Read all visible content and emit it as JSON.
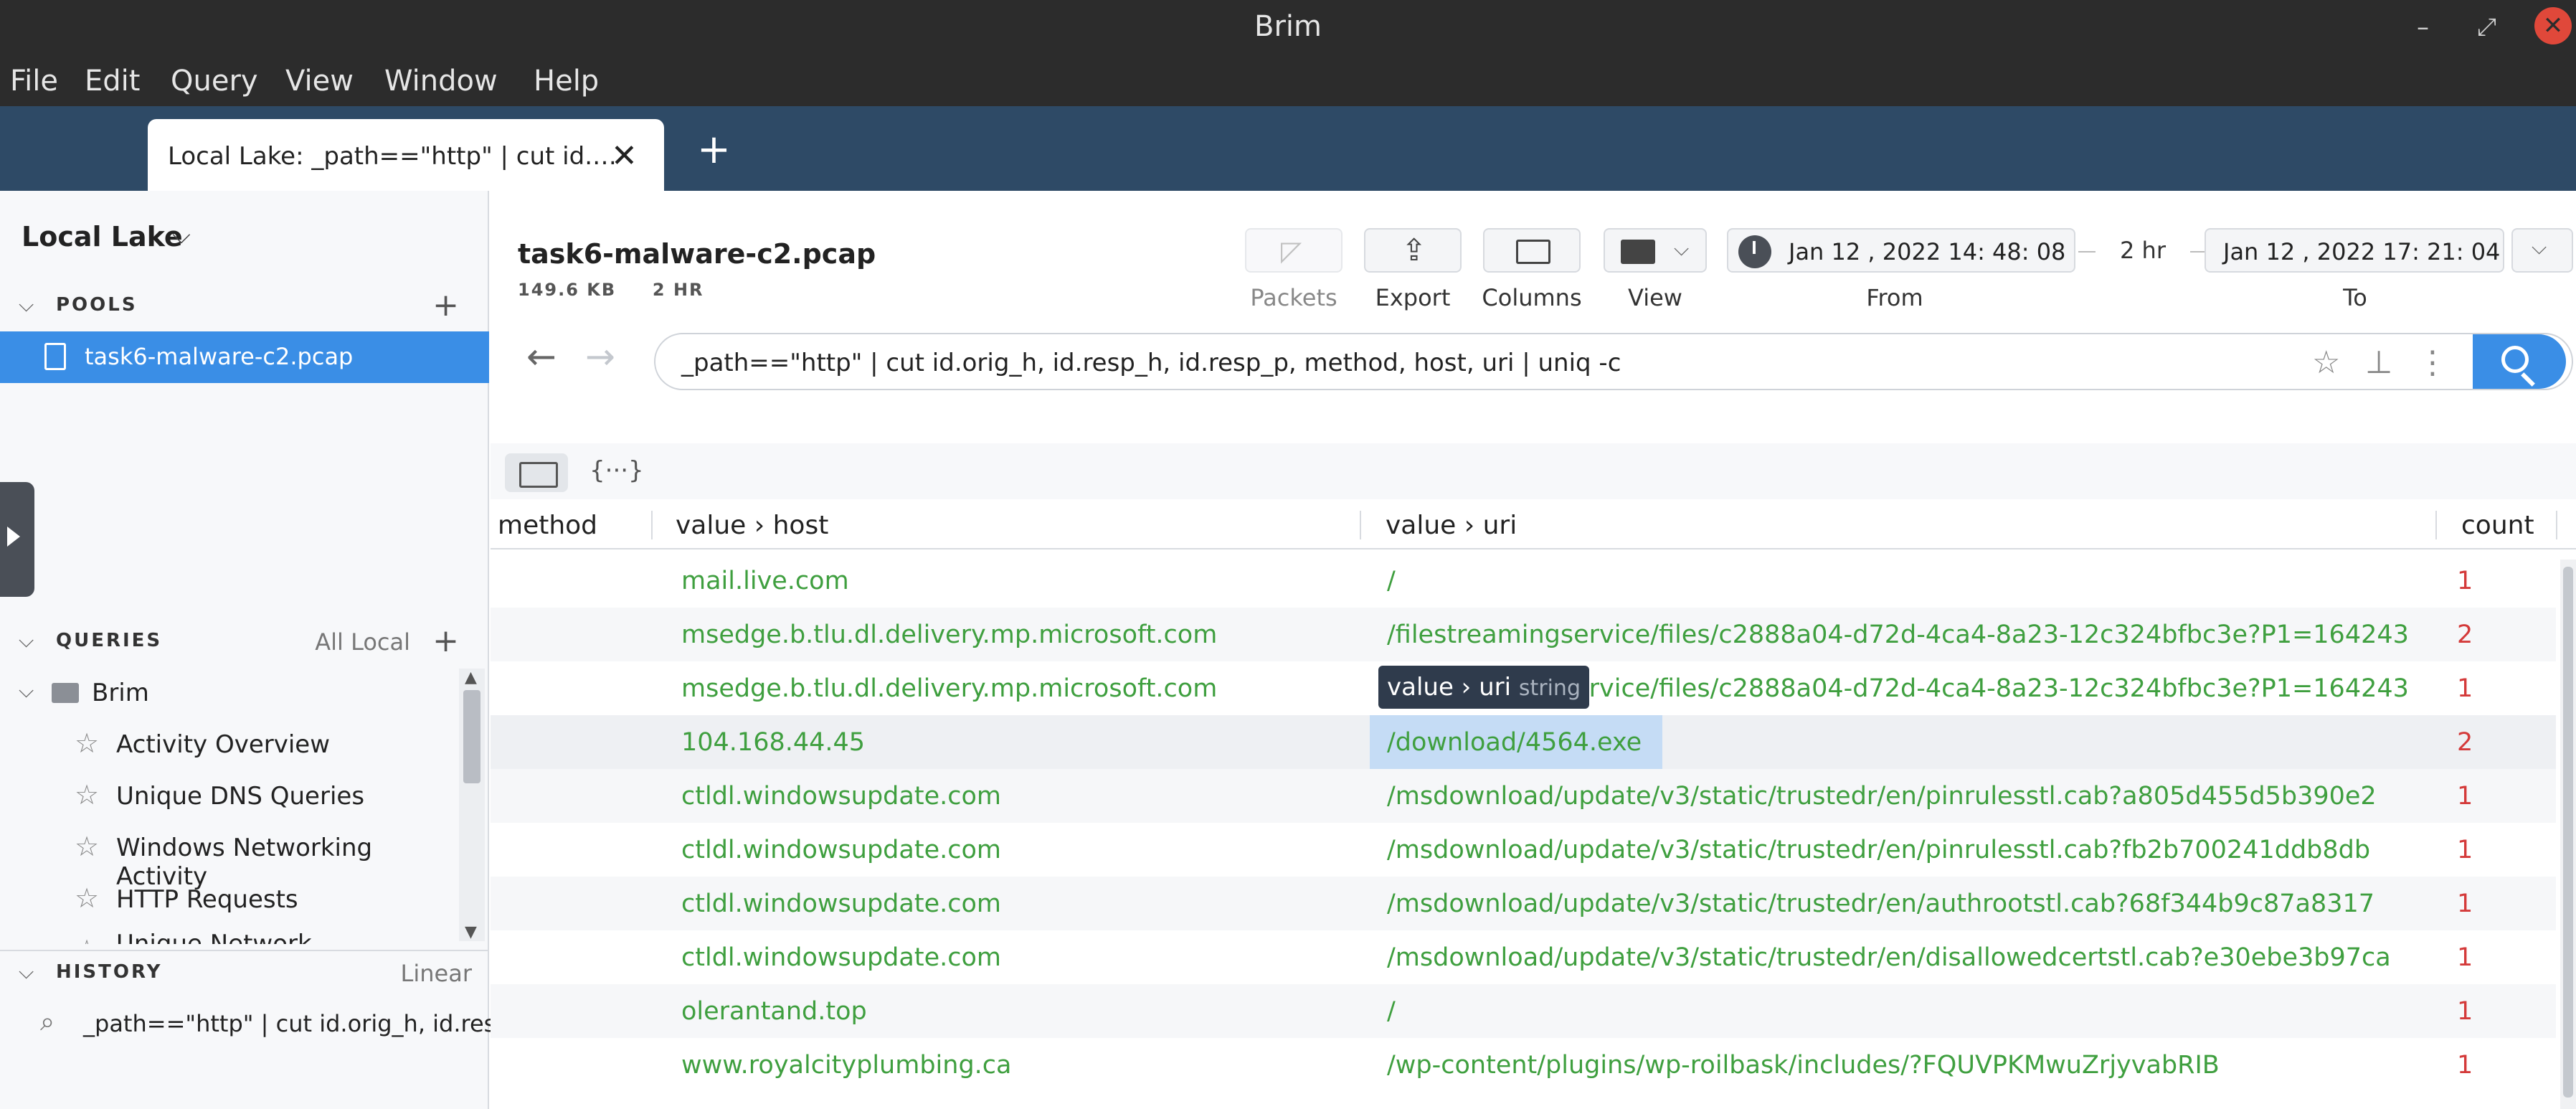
{
  "window": {
    "title": "Brim"
  },
  "menu": [
    "File",
    "Edit",
    "Query",
    "View",
    "Window",
    "Help"
  ],
  "tabs": [
    {
      "label": "Local Lake: _path==\"http\" | cut id.…"
    }
  ],
  "sidebar": {
    "lake": "Local Lake",
    "pools_label": "POOLS",
    "pools": [
      "task6-malware-c2.pcap"
    ],
    "queries_label": "QUERIES",
    "queries_filter": "All Local",
    "query_folder": "Brim",
    "queries": [
      "Activity Overview",
      "Unique DNS Queries",
      "Windows Networking Activity",
      "HTTP Requests",
      "Unique Network Connections"
    ],
    "history_label": "HISTORY",
    "history_filter": "Linear",
    "history": [
      "_path==\"http\" | cut id.orig_h, id.res…"
    ]
  },
  "header": {
    "pcap": "task6-malware-c2.pcap",
    "size": "149.6 KB",
    "duration": "2 HR",
    "toolbar": {
      "packets": "Packets",
      "export": "Export",
      "columns": "Columns",
      "view": "View"
    },
    "from": "Jan  12 , 2022  14: 48: 08",
    "from_label": "From",
    "span": "2 hr",
    "to": "Jan  12 , 2022  17: 21: 04",
    "to_label": "To"
  },
  "search": {
    "query": "_path==\"http\" | cut id.orig_h, id.resp_h, id.resp_p, method, host, uri | uniq -c"
  },
  "columns": {
    "method": "method",
    "host": "value › host",
    "uri": "value › uri",
    "count": "count"
  },
  "rows": [
    {
      "host": "mail.live.com",
      "uri": "/",
      "count": "1"
    },
    {
      "host": "msedge.b.tlu.dl.delivery.mp.microsoft.com",
      "uri": "/filestreamingservice/files/c2888a04-d72d-4ca4-8a23-12c324bfbc3e?P1=164243",
      "count": "2"
    },
    {
      "host": "msedge.b.tlu.dl.delivery.mp.microsoft.com",
      "uri": "/filestreamingservice/files/c2888a04-d72d-4ca4-8a23-12c324bfbc3e?P1=164243",
      "count": "1"
    },
    {
      "host": "104.168.44.45",
      "uri": "/download/4564.exe",
      "count": "2"
    },
    {
      "host": "ctldl.windowsupdate.com",
      "uri": "/msdownload/update/v3/static/trustedr/en/pinrulesstl.cab?a805d455d5b390e2",
      "count": "1"
    },
    {
      "host": "ctldl.windowsupdate.com",
      "uri": "/msdownload/update/v3/static/trustedr/en/pinrulesstl.cab?fb2b700241ddb8db",
      "count": "1"
    },
    {
      "host": "ctldl.windowsupdate.com",
      "uri": "/msdownload/update/v3/static/trustedr/en/authrootstl.cab?68f344b9c87a8317",
      "count": "1"
    },
    {
      "host": "ctldl.windowsupdate.com",
      "uri": "/msdownload/update/v3/static/trustedr/en/disallowedcertstl.cab?e30ebe3b97ca",
      "count": "1"
    },
    {
      "host": "olerantand.top",
      "uri": "/",
      "count": "1"
    },
    {
      "host": "www.royalcityplumbing.ca",
      "uri": "/wp-content/plugins/wp-roilbask/includes/?FQUVPKMwuZrjyvabRIB",
      "count": "1"
    }
  ],
  "tooltip": {
    "field": "value › uri",
    "type": "string"
  }
}
